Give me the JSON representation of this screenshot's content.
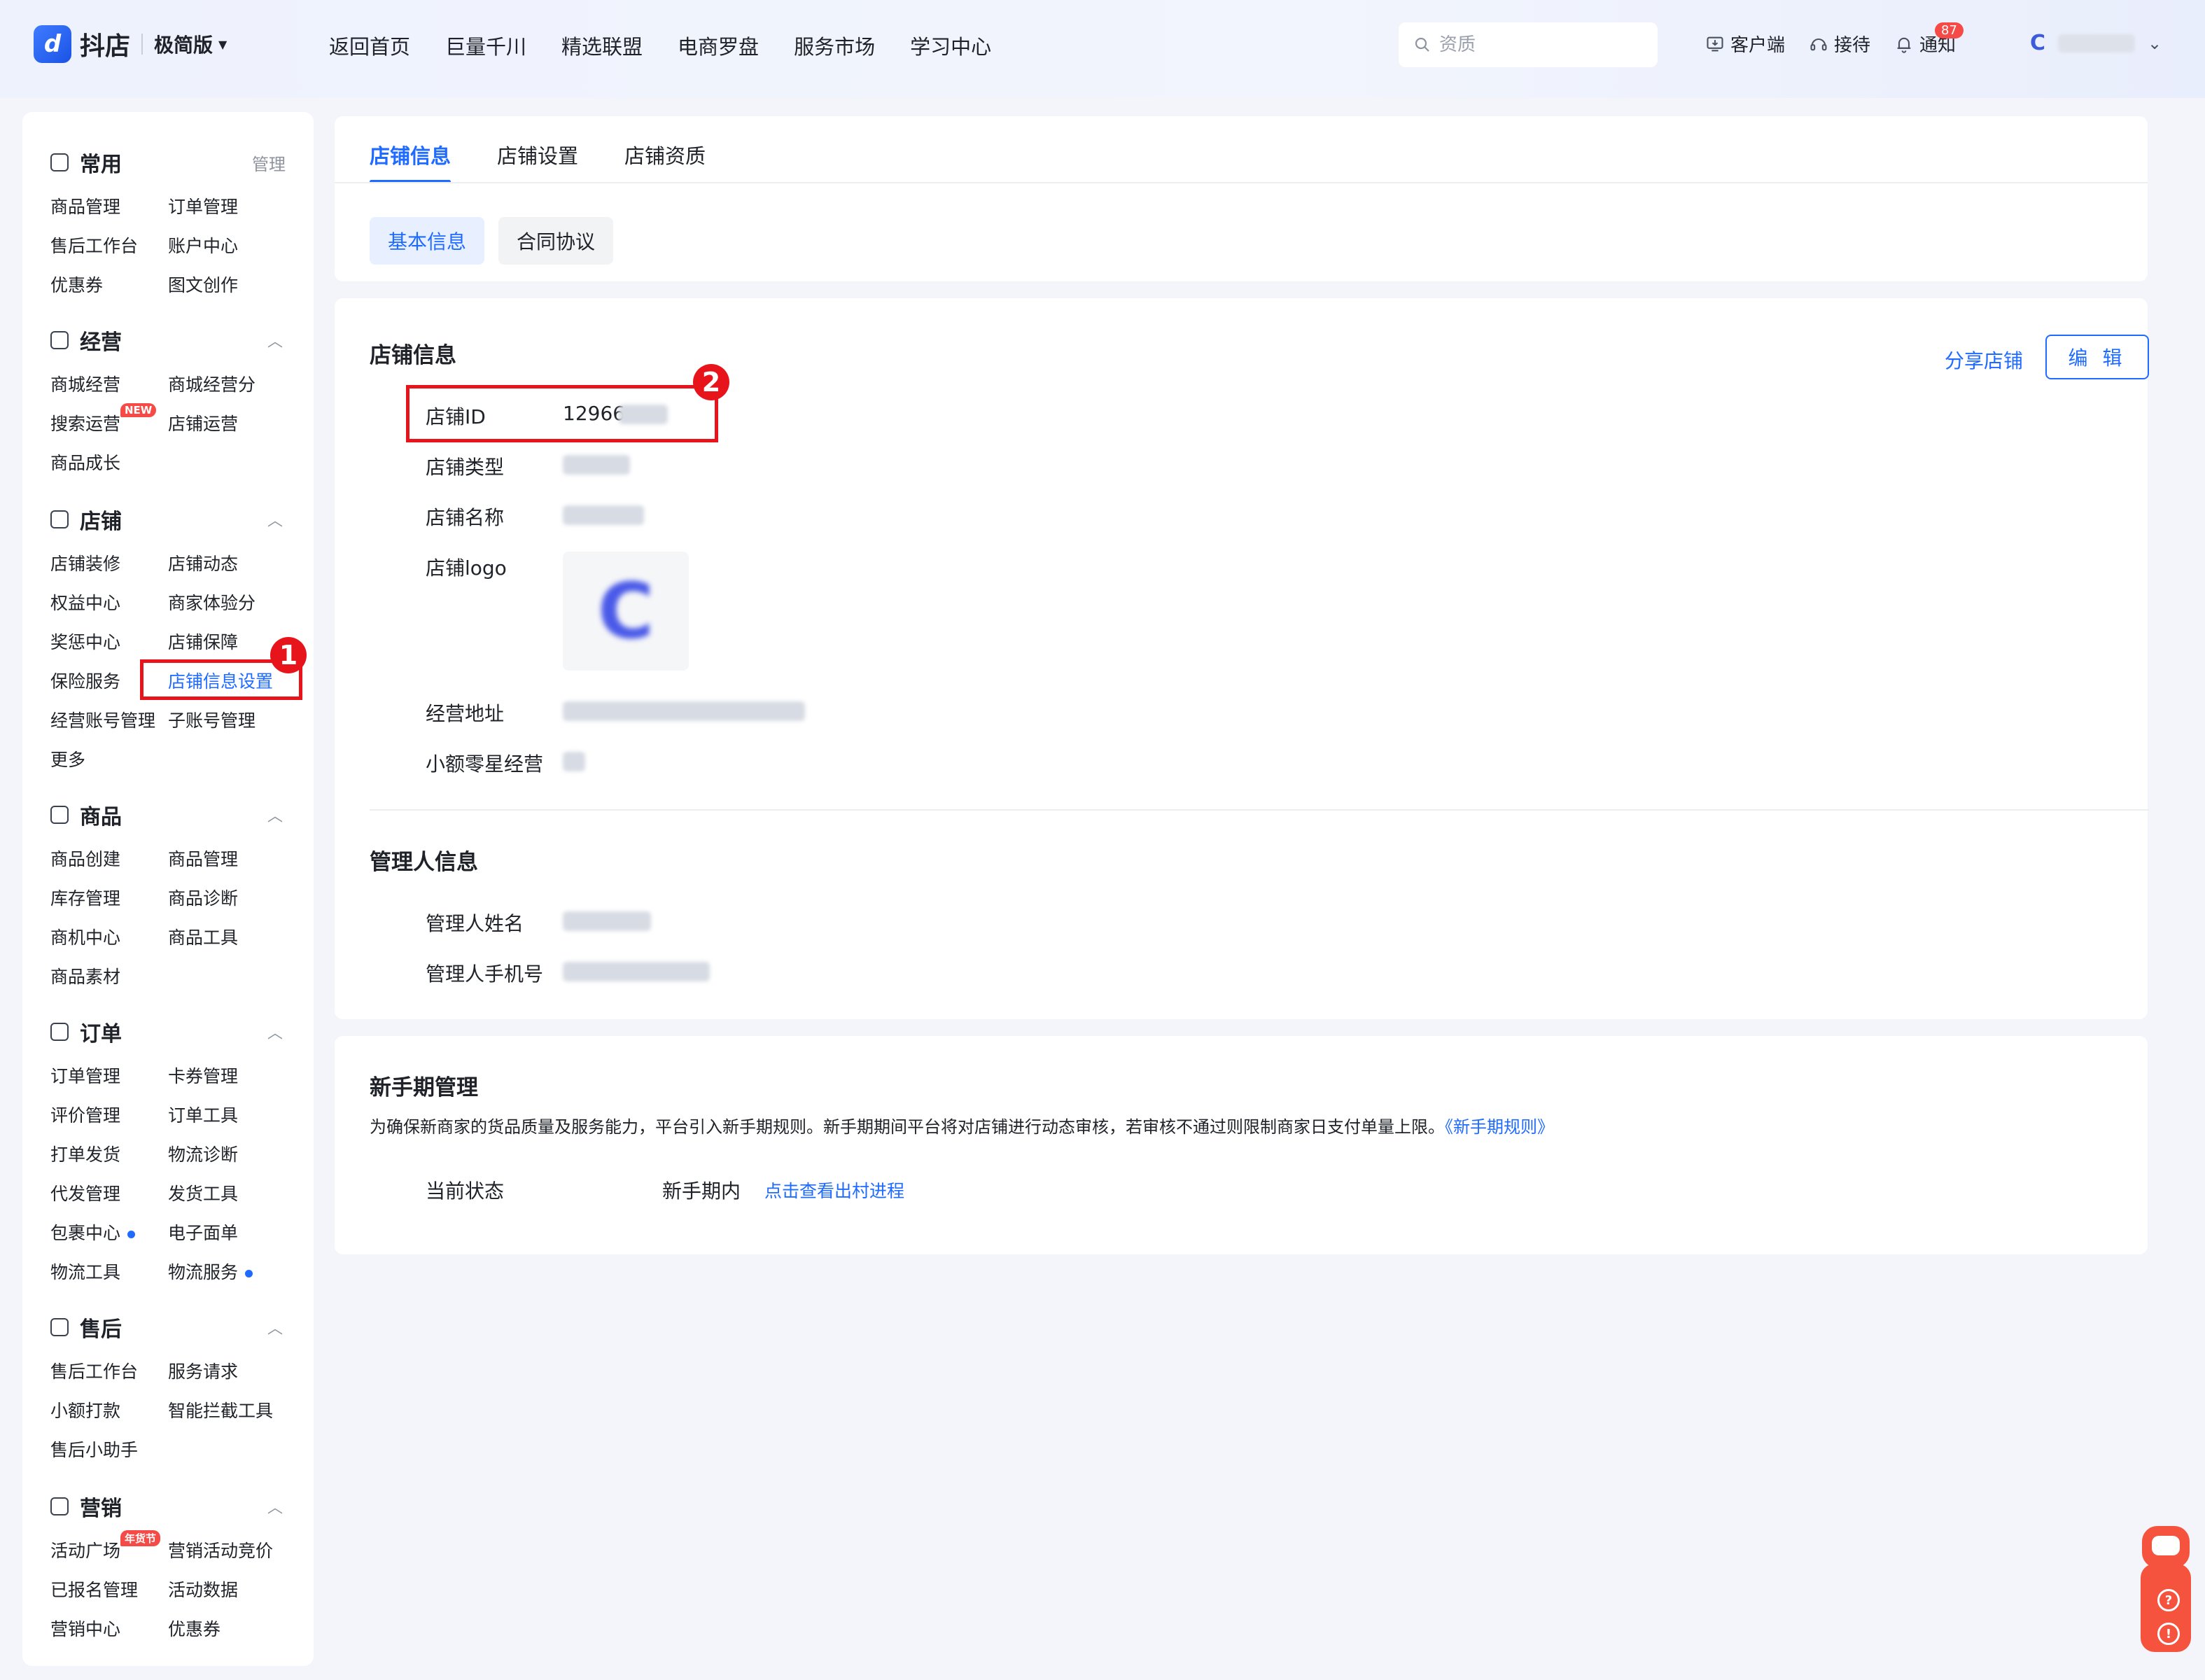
{
  "header": {
    "logo_text": "抖店",
    "edition": "极简版",
    "nav": [
      "返回首页",
      "巨量千川",
      "精选联盟",
      "电商罗盘",
      "服务市场",
      "学习中心"
    ],
    "search_placeholder": "资质",
    "actions": {
      "client": "客户端",
      "reception": "接待",
      "notify": "通知",
      "notify_count": "87"
    },
    "avatar_letter": "C"
  },
  "sidebar": {
    "common": {
      "title": "常用",
      "manage": "管理",
      "items": [
        "商品管理",
        "订单管理",
        "售后工作台",
        "账户中心",
        "优惠券",
        "图文创作"
      ]
    },
    "operation": {
      "title": "经营",
      "items": [
        "商城经营",
        "商城经营分",
        "搜索运营",
        "店铺运营",
        "商品成长"
      ],
      "new_badge": "NEW"
    },
    "shop": {
      "title": "店铺",
      "items": [
        "店铺装修",
        "店铺动态",
        "权益中心",
        "商家体验分",
        "奖惩中心",
        "店铺保障",
        "保险服务",
        "店铺信息设置",
        "经营账号管理",
        "子账号管理",
        "更多"
      ]
    },
    "goods": {
      "title": "商品",
      "items": [
        "商品创建",
        "商品管理",
        "库存管理",
        "商品诊断",
        "商机中心",
        "商品工具",
        "商品素材"
      ]
    },
    "order": {
      "title": "订单",
      "items": [
        "订单管理",
        "卡券管理",
        "评价管理",
        "订单工具",
        "打单发货",
        "物流诊断",
        "代发管理",
        "发货工具",
        "包裹中心",
        "电子面单",
        "物流工具",
        "物流服务"
      ]
    },
    "aftersale": {
      "title": "售后",
      "items": [
        "售后工作台",
        "服务请求",
        "小额打款",
        "智能拦截工具",
        "售后小助手"
      ]
    },
    "marketing": {
      "title": "营销",
      "items": [
        "活动广场",
        "营销活动竞价",
        "已报名管理",
        "活动数据",
        "营销中心",
        "优惠券"
      ],
      "badge": "年货节"
    }
  },
  "markers": {
    "one": "1",
    "two": "2"
  },
  "tabs": [
    "店铺信息",
    "店铺设置",
    "店铺资质"
  ],
  "subtabs": [
    "基本信息",
    "合同协议"
  ],
  "shop_info": {
    "title": "店铺信息",
    "share": "分享店铺",
    "edit": "编 辑",
    "labels": {
      "id": "店铺ID",
      "type": "店铺类型",
      "name": "店铺名称",
      "logo": "店铺logo",
      "address": "经营地址",
      "small": "小额零星经营"
    },
    "id_value": "12966"
  },
  "manager": {
    "title": "管理人信息",
    "name_label": "管理人姓名",
    "phone_label": "管理人手机号"
  },
  "newbie": {
    "title": "新手期管理",
    "desc": "为确保新商家的货品质量及服务能力，平台引入新手期规则。新手期期间平台将对店铺进行动态审核，若审核不通过则限制商家日支付单量上限。",
    "rule_link": "《新手期规则》",
    "status_label": "当前状态",
    "status_value": "新手期内",
    "progress_link": "点击查看出村进程"
  },
  "colors": {
    "accent": "#1f6bff",
    "highlight": "#e8141b",
    "bg": "#f3f5fa"
  }
}
